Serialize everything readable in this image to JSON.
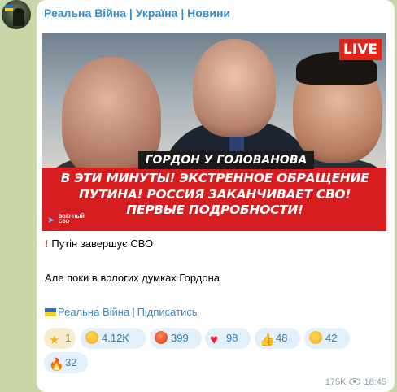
{
  "channel": {
    "title": "Реальна Війна | Україна | Новини"
  },
  "media": {
    "live_badge": "LIVE",
    "banner_label": "ГОРДОН У ГОЛОВАНОВА",
    "headline_lines": [
      "В ЭТИ МИНУТЫ! ЭКСТРЕННОЕ ОБРАЩЕНИЕ",
      "ПУТИНА! РОССИЯ ЗАКАНЧИВАЕТ СВО!",
      "ПЕРВЫЕ ПОДРОБНОСТИ!"
    ],
    "corner_logo_text": "ВОЕННЫЙ СВО"
  },
  "message": {
    "line1": "Путін завершує СВО",
    "line2": "Але поки в вологих думках Гордона",
    "channel_link": "Реальна Війна",
    "separator": "|",
    "subscribe_link": "Підписатись"
  },
  "reactions": [
    {
      "icon": "star-icon",
      "count": "1"
    },
    {
      "icon": "grin-icon",
      "count": "4.12K"
    },
    {
      "icon": "angry-icon",
      "count": "399"
    },
    {
      "icon": "heart-icon",
      "count": "98"
    },
    {
      "icon": "thumbs-up-icon",
      "count": "48"
    },
    {
      "icon": "crying-icon",
      "count": "42"
    },
    {
      "icon": "fire-icon",
      "count": "32"
    }
  ],
  "meta": {
    "views": "175K",
    "time": "18:45"
  },
  "colors": {
    "background": "#c9d6a7",
    "accent": "#3a8cc8",
    "banner_red": "#d61e20",
    "live_red": "#e2231a"
  }
}
